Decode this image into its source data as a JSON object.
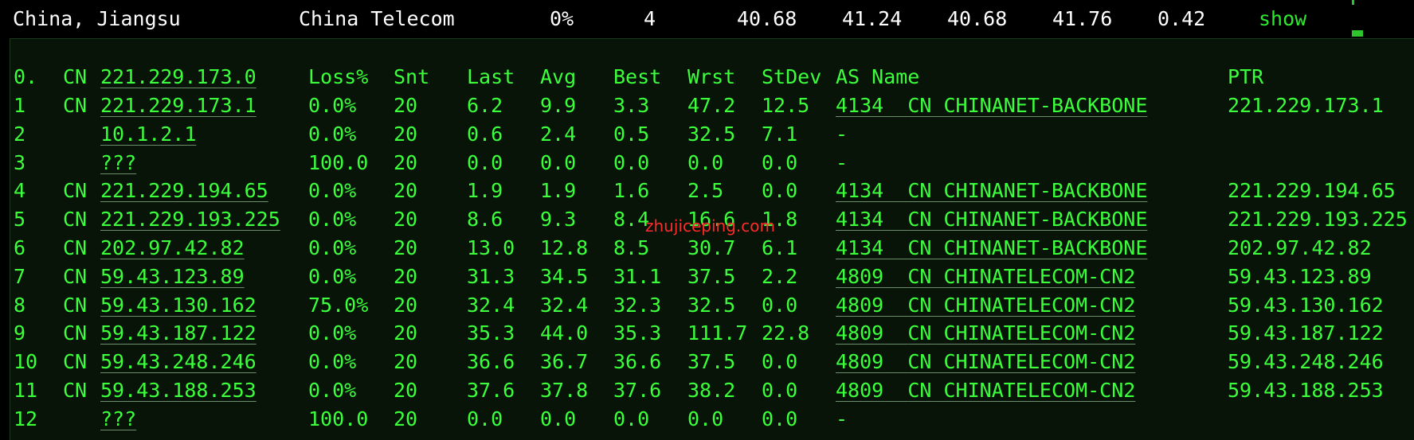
{
  "summary": {
    "location": "China, Jiangsu",
    "isp": "China Telecom",
    "loss": "0%",
    "count": "4",
    "v1": "40.68",
    "v2": "41.24",
    "v3": "40.68",
    "v4": "41.76",
    "v5": "0.42",
    "show": "show"
  },
  "header": {
    "idx": "0.",
    "cc": "CN",
    "host": "221.229.173.0",
    "loss": "Loss%",
    "snt": "Snt",
    "last": "Last",
    "avg": "Avg",
    "best": "Best",
    "wrst": "Wrst",
    "stdev": "StDev",
    "asname": "AS Name",
    "ptr": "PTR"
  },
  "hops": [
    {
      "idx": "1",
      "cc": "CN",
      "host": "221.229.173.1",
      "loss": "0.0%",
      "snt": "20",
      "last": "6.2",
      "avg": "9.9",
      "best": "3.3",
      "wrst": "47.2",
      "stdev": "12.5",
      "as": "4134",
      "ascc": "CN",
      "asname": "CHINANET-BACKBONE",
      "ptr": "221.229.173.1"
    },
    {
      "idx": "2",
      "cc": "",
      "host": "10.1.2.1",
      "loss": "0.0%",
      "snt": "20",
      "last": "0.6",
      "avg": "2.4",
      "best": "0.5",
      "wrst": "32.5",
      "stdev": "7.1",
      "as": "-",
      "ascc": "",
      "asname": "",
      "ptr": ""
    },
    {
      "idx": "3",
      "cc": "",
      "host": "???",
      "loss": "100.0",
      "snt": "20",
      "last": "0.0",
      "avg": "0.0",
      "best": "0.0",
      "wrst": "0.0",
      "stdev": "0.0",
      "as": "-",
      "ascc": "",
      "asname": "",
      "ptr": ""
    },
    {
      "idx": "4",
      "cc": "CN",
      "host": "221.229.194.65",
      "loss": "0.0%",
      "snt": "20",
      "last": "1.9",
      "avg": "1.9",
      "best": "1.6",
      "wrst": "2.5",
      "stdev": "0.0",
      "as": "4134",
      "ascc": "CN",
      "asname": "CHINANET-BACKBONE",
      "ptr": "221.229.194.65"
    },
    {
      "idx": "5",
      "cc": "CN",
      "host": "221.229.193.225",
      "loss": "0.0%",
      "snt": "20",
      "last": "8.6",
      "avg": "9.3",
      "best": "8.4",
      "wrst": "16.6",
      "stdev": "1.8",
      "as": "4134",
      "ascc": "CN",
      "asname": "CHINANET-BACKBONE",
      "ptr": "221.229.193.225"
    },
    {
      "idx": "6",
      "cc": "CN",
      "host": "202.97.42.82",
      "loss": "0.0%",
      "snt": "20",
      "last": "13.0",
      "avg": "12.8",
      "best": "8.5",
      "wrst": "30.7",
      "stdev": "6.1",
      "as": "4134",
      "ascc": "CN",
      "asname": "CHINANET-BACKBONE",
      "ptr": "202.97.42.82"
    },
    {
      "idx": "7",
      "cc": "CN",
      "host": "59.43.123.89",
      "loss": "0.0%",
      "snt": "20",
      "last": "31.3",
      "avg": "34.5",
      "best": "31.1",
      "wrst": "37.5",
      "stdev": "2.2",
      "as": "4809",
      "ascc": "CN",
      "asname": "CHINATELECOM-CN2",
      "ptr": "59.43.123.89"
    },
    {
      "idx": "8",
      "cc": "CN",
      "host": "59.43.130.162",
      "loss": "75.0%",
      "snt": "20",
      "last": "32.4",
      "avg": "32.4",
      "best": "32.3",
      "wrst": "32.5",
      "stdev": "0.0",
      "as": "4809",
      "ascc": "CN",
      "asname": "CHINATELECOM-CN2",
      "ptr": "59.43.130.162"
    },
    {
      "idx": "9",
      "cc": "CN",
      "host": "59.43.187.122",
      "loss": "0.0%",
      "snt": "20",
      "last": "35.3",
      "avg": "44.0",
      "best": "35.3",
      "wrst": "111.7",
      "stdev": "22.8",
      "as": "4809",
      "ascc": "CN",
      "asname": "CHINATELECOM-CN2",
      "ptr": "59.43.187.122"
    },
    {
      "idx": "10",
      "cc": "CN",
      "host": "59.43.248.246",
      "loss": "0.0%",
      "snt": "20",
      "last": "36.6",
      "avg": "36.7",
      "best": "36.6",
      "wrst": "37.5",
      "stdev": "0.0",
      "as": "4809",
      "ascc": "CN",
      "asname": "CHINATELECOM-CN2",
      "ptr": "59.43.248.246"
    },
    {
      "idx": "11",
      "cc": "CN",
      "host": "59.43.188.253",
      "loss": "0.0%",
      "snt": "20",
      "last": "37.6",
      "avg": "37.8",
      "best": "37.6",
      "wrst": "38.2",
      "stdev": "0.0",
      "as": "4809",
      "ascc": "CN",
      "asname": "CHINATELECOM-CN2",
      "ptr": "59.43.188.253"
    },
    {
      "idx": "12",
      "cc": "",
      "host": "???",
      "loss": "100.0",
      "snt": "20",
      "last": "0.0",
      "avg": "0.0",
      "best": "0.0",
      "wrst": "0.0",
      "stdev": "0.0",
      "as": "-",
      "ascc": "",
      "asname": "",
      "ptr": ""
    }
  ],
  "watermark": "zhujiceping.com",
  "colors": {
    "text_green": "#3cff3c",
    "link_green": "#2ee82e",
    "panel_bg": "#071407",
    "watermark": "#ff2a2a"
  }
}
